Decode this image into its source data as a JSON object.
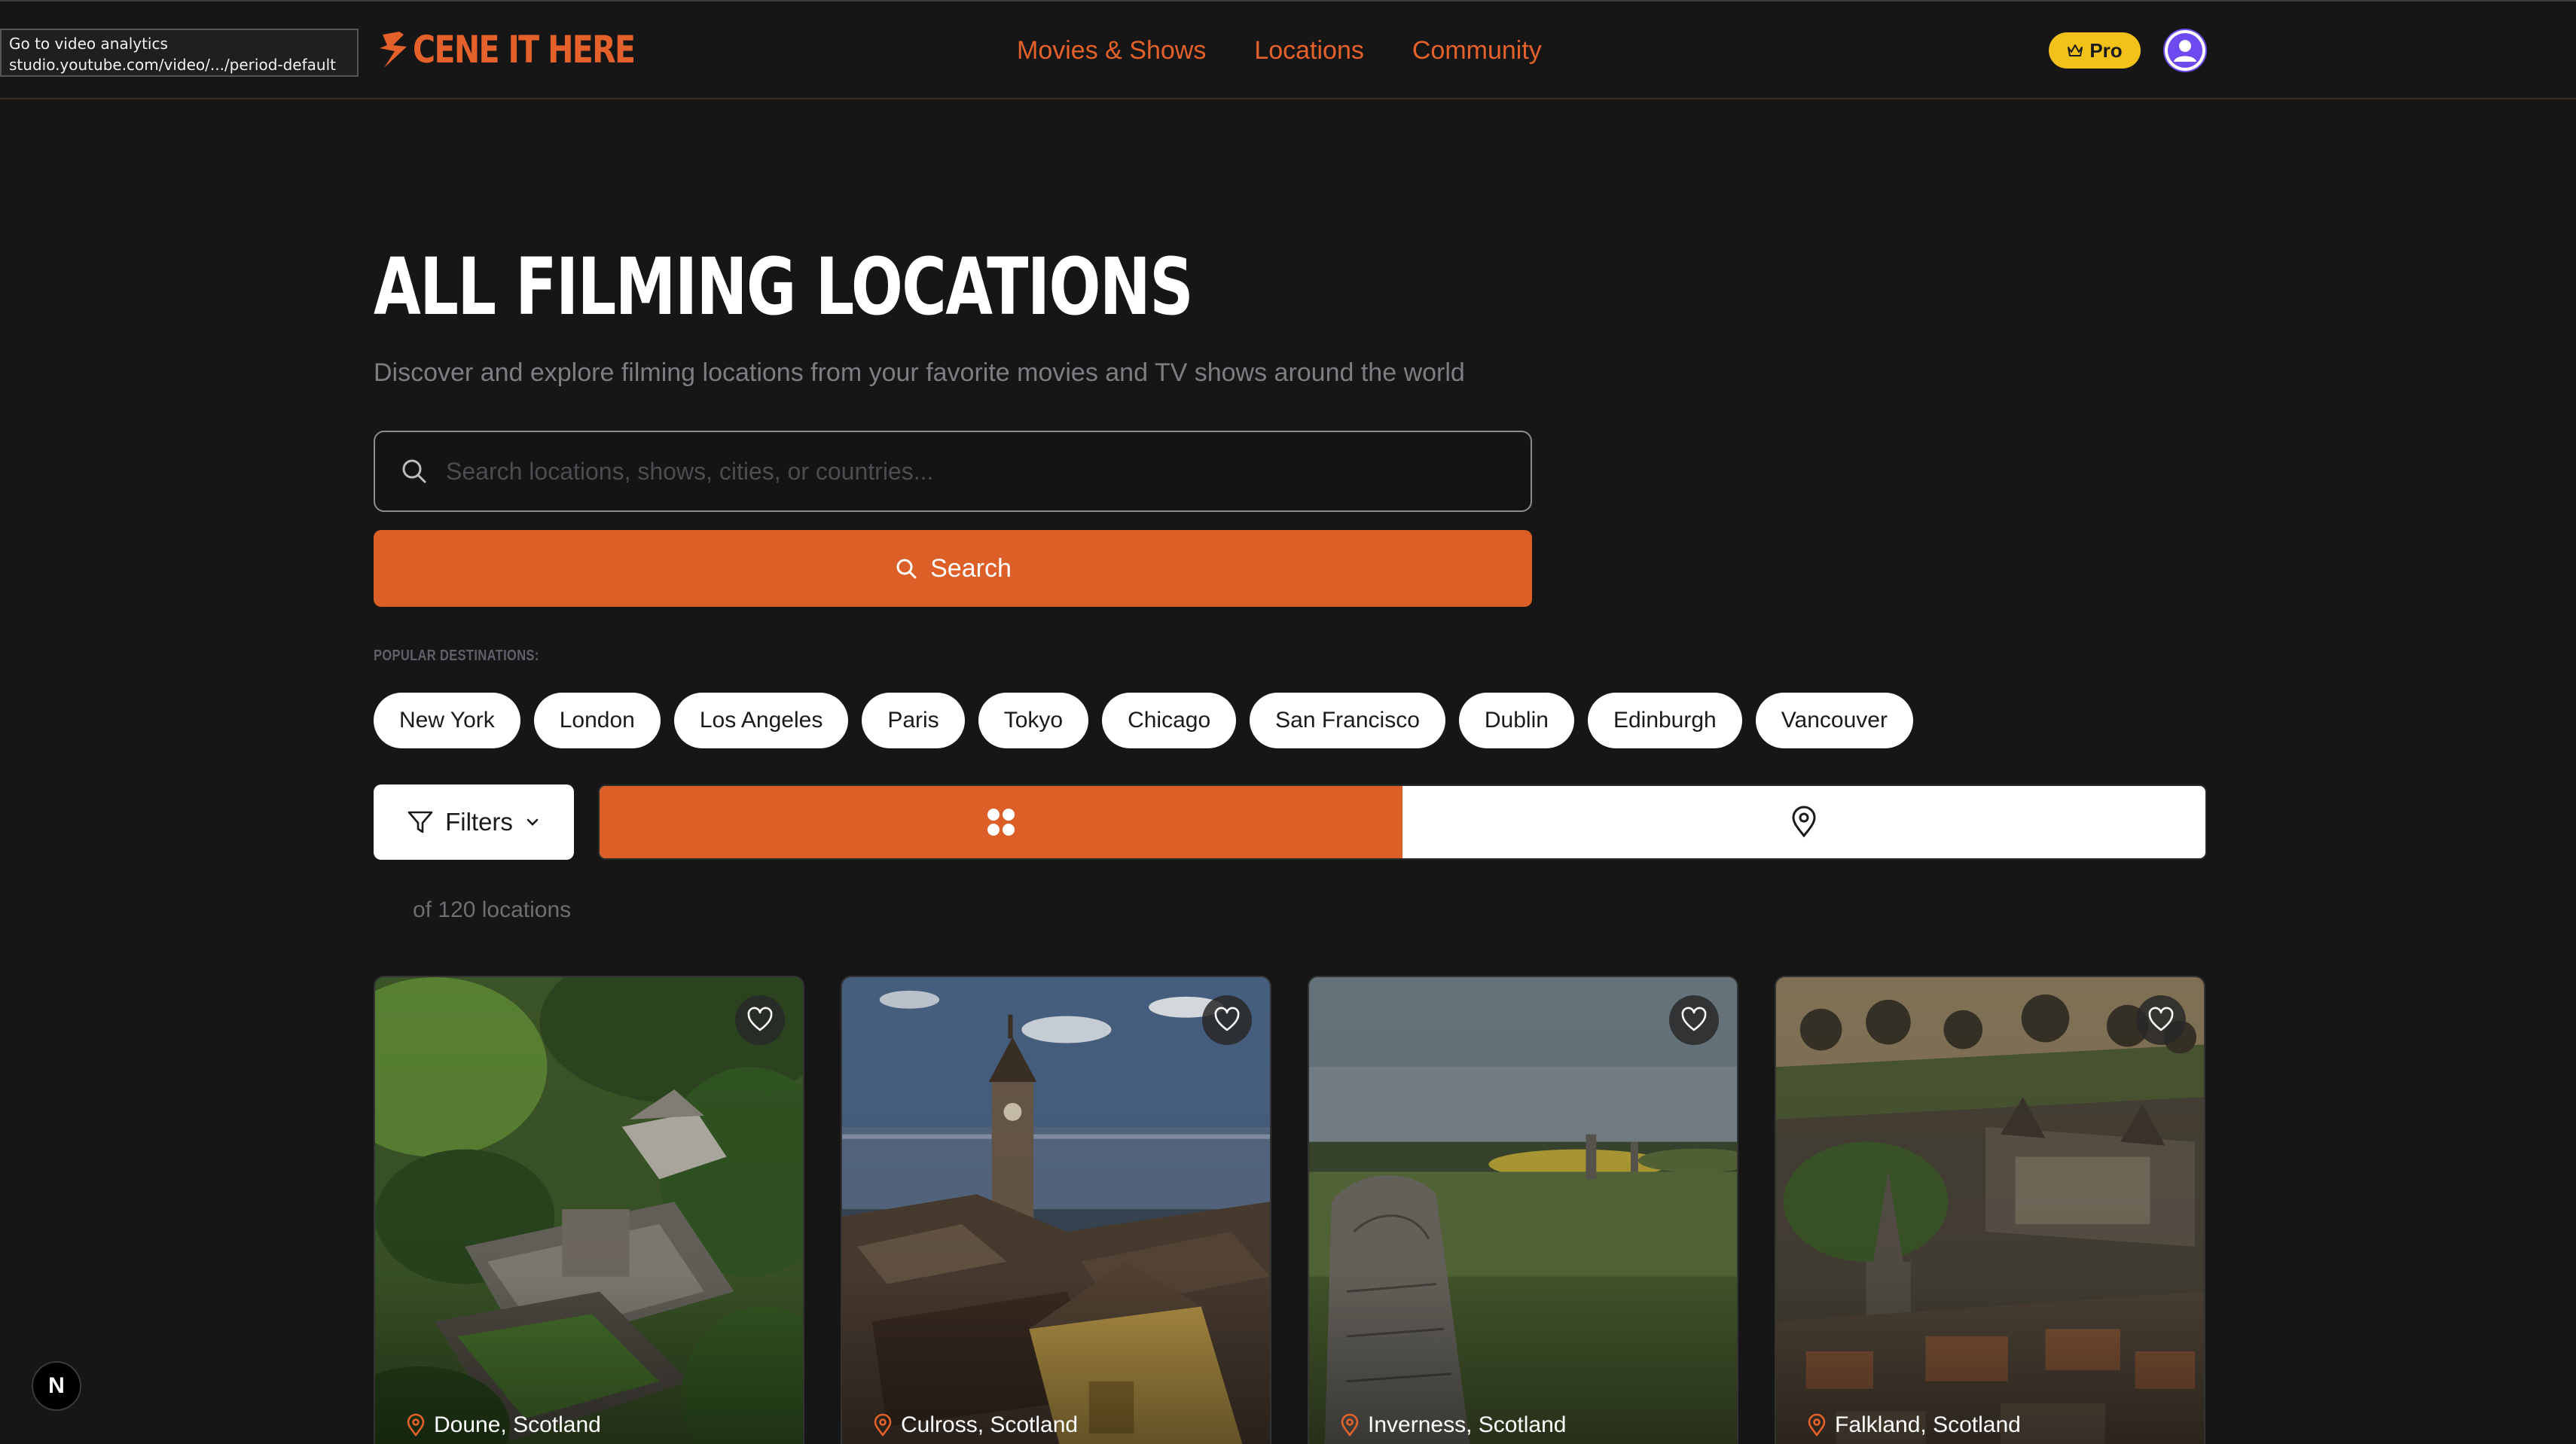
{
  "tooltip": {
    "line1": "Go to video analytics",
    "line2": "studio.youtube.com/video/.../period-default"
  },
  "header": {
    "logo_text": "CENE IT HERE",
    "nav": [
      "Movies & Shows",
      "Locations",
      "Community"
    ],
    "pro_label": "Pro",
    "icons": {
      "logo": "scene-logo-icon",
      "crown": "crown-icon",
      "avatar": "user-avatar-icon"
    }
  },
  "hero": {
    "title": "ALL FILMING LOCATIONS",
    "subtitle": "Discover and explore filming locations from your favorite movies and TV shows around the world"
  },
  "search": {
    "value": "",
    "placeholder": "Search locations, shows, cities, or countries...",
    "button_label": "Search"
  },
  "popular": {
    "label": "POPULAR DESTINATIONS:",
    "items": [
      "New York",
      "London",
      "Los Angeles",
      "Paris",
      "Tokyo",
      "Chicago",
      "San Francisco",
      "Dublin",
      "Edinburgh",
      "Vancouver"
    ]
  },
  "toolbar": {
    "filters_label": "Filters",
    "views": [
      "grid-view",
      "map-view"
    ],
    "active_view": "grid-view",
    "count_text": "of 120 locations"
  },
  "cards": [
    {
      "location": "Doune, Scotland"
    },
    {
      "location": "Culross, Scotland"
    },
    {
      "location": "Inverness, Scotland"
    },
    {
      "location": "Falkland, Scotland"
    }
  ],
  "footer": {
    "next_badge": "N"
  },
  "colors": {
    "accent": "#dd5f28",
    "background": "#161616",
    "pro": "#f2c21b",
    "avatar": "#6d4bf0"
  }
}
